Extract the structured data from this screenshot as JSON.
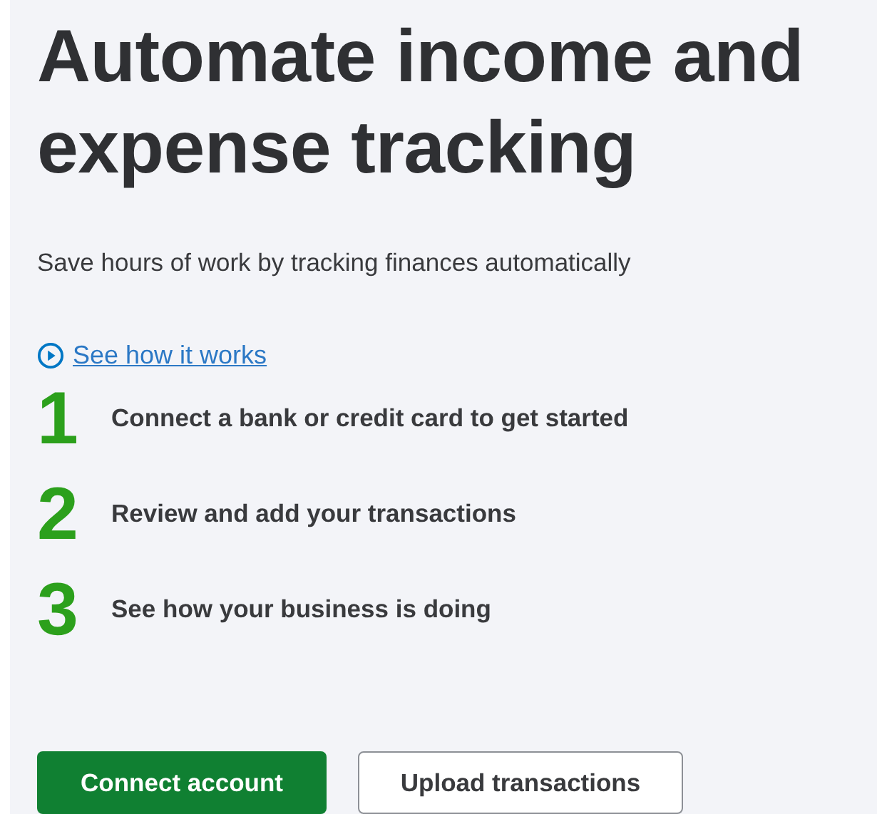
{
  "heading": "Automate income and expense tracking",
  "subtitle": "Save hours of work by tracking finances automatically",
  "video_link": {
    "label": "See how it works"
  },
  "steps": [
    {
      "number": "1",
      "text": "Connect a bank or credit card to get started"
    },
    {
      "number": "2",
      "text": "Review and add your transactions"
    },
    {
      "number": "3",
      "text": "See how your business is doing"
    }
  ],
  "buttons": [
    {
      "label": "Connect account",
      "kind": "primary"
    },
    {
      "label": "Upload transactions",
      "kind": "secondary"
    }
  ]
}
